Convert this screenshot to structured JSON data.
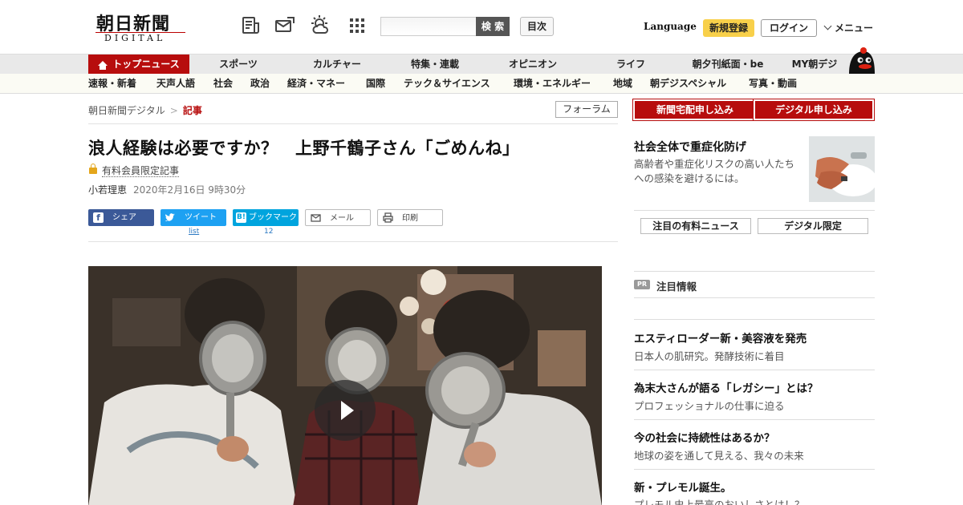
{
  "header": {
    "logo_main": "朝日新聞",
    "logo_sub": "DIGITAL",
    "icons": [
      "newspaper-icon",
      "mail-icon",
      "weather-icon",
      "grid-icon"
    ],
    "search_placeholder": "",
    "search_label": "検 索",
    "toc_label": "目次",
    "language_label": "Language",
    "register_label": "新規登録",
    "login_label": "ログイン",
    "menu_label": "メニュー"
  },
  "nav_primary": [
    "トップニュース",
    "スポーツ",
    "カルチャー",
    "特集・連載",
    "オピニオン",
    "ライフ",
    "朝夕刊紙面・be",
    "MY朝デジ"
  ],
  "nav_secondary": [
    "速報・新着",
    "天声人語",
    "社会",
    "政治",
    "経済・マネー",
    "国際",
    "テック＆サイエンス",
    "環境・エネルギー",
    "地域",
    "朝デジスペシャル",
    "写真・動画"
  ],
  "breadcrumb": {
    "home": "朝日新聞デジタル",
    "separator": ">",
    "current": "記事"
  },
  "forum_label": "フォーラム",
  "article": {
    "headline": "浪人経験は必要ですか？　上野千鶴子さん「ごめんね」",
    "paid_label": "有料会員限定記事",
    "author": "小若理恵",
    "date": "2020年2月16日 9時30分"
  },
  "share": {
    "facebook": "シェア",
    "twitter": "ツイート",
    "hatena": "ブックマーク",
    "mail": "メール",
    "print": "印刷",
    "twitter_count": "list",
    "hatena_count": "12"
  },
  "sidebar": {
    "newspaper_subscribe": "新聞宅配申し込み",
    "digital_subscribe": "デジタル申し込み",
    "featured_title": "社会全体で重症化防げ",
    "featured_desc": "高齢者や重症化リスクの高い人たちへの感染を避けるには。",
    "tab_paid_news": "注目の有料ニュース",
    "tab_digital_only": "デジタル限定",
    "pr_badge": "PR",
    "pr_heading": "注目情報",
    "pr_items": [
      {
        "title": "エスティローダー新・美容液を発売",
        "desc": "日本人の肌研究。発酵技術に着目"
      },
      {
        "title": "為末大さんが語る「レガシー」とは？",
        "desc": "プロフェッショナルの仕事に迫る"
      },
      {
        "title": "今の社会に持続性はあるか？",
        "desc": "地球の姿を通して見える、我々の未来"
      },
      {
        "title": "新・プレモル誕生。",
        "desc": "プレモル史上最高のおいしさとは！？"
      }
    ]
  },
  "colors": {
    "brand_red": "#b70d0d",
    "register_yellow": "#f8d04a",
    "facebook": "#3b5998",
    "twitter": "#1da1f2",
    "hatena": "#00a4de"
  }
}
